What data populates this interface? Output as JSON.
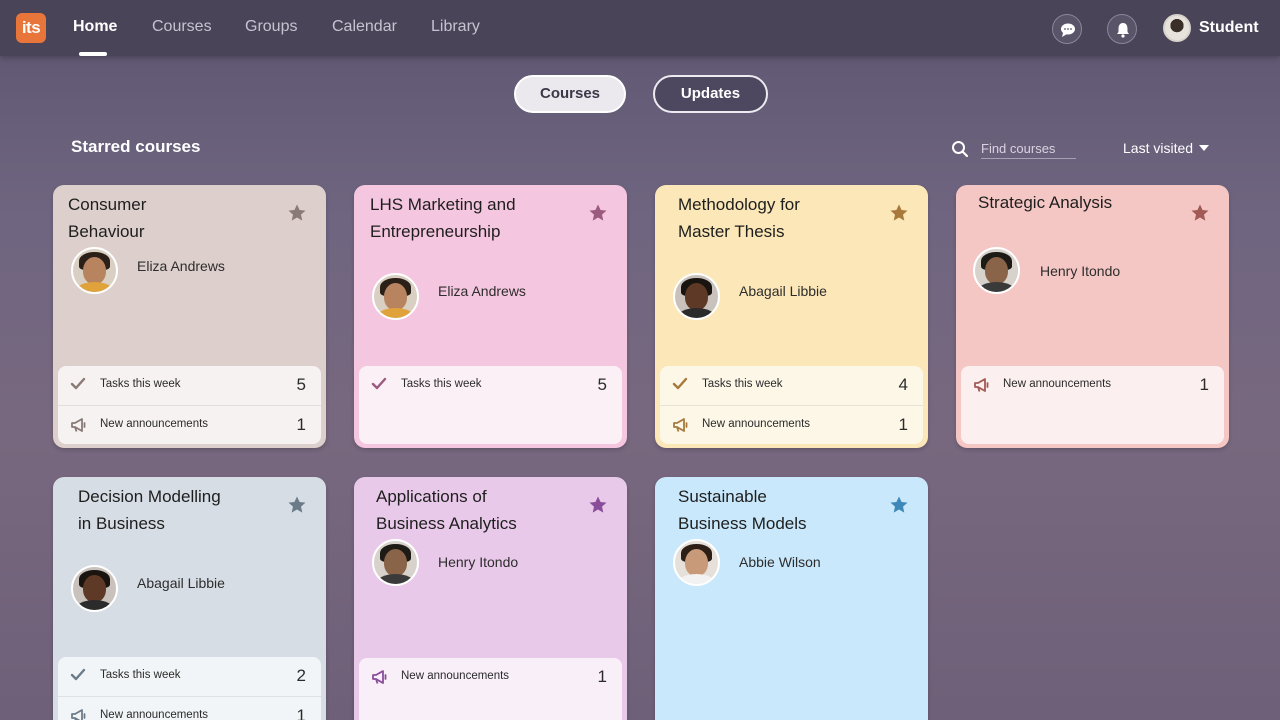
{
  "app": {
    "logo_text": "its"
  },
  "nav": {
    "items": [
      {
        "label": "Home"
      },
      {
        "label": "Courses"
      },
      {
        "label": "Groups"
      },
      {
        "label": "Calendar"
      },
      {
        "label": "Library"
      }
    ],
    "user_name": "Student"
  },
  "segmented": {
    "courses": "Courses",
    "updates": "Updates"
  },
  "section": {
    "title": "Starred courses",
    "search_placeholder": "Find courses",
    "sort_label": "Last visited"
  },
  "stat_labels": {
    "tasks": "Tasks this week",
    "announcements": "New announcements"
  },
  "cards": [
    {
      "title": "Consumer\nBehaviour",
      "teacher": "Eliza Andrews",
      "tasks": "5",
      "announcements": "1",
      "color": "#ddd0cc",
      "accent": "#8a7a76"
    },
    {
      "title": "LHS Marketing and\nEntrepreneurship",
      "teacher": "Eliza Andrews",
      "tasks": "5",
      "color": "#f5c6df",
      "accent": "#9a5b7e"
    },
    {
      "title": "Methodology for\nMaster Thesis",
      "teacher": "Abagail Libbie",
      "tasks": "4",
      "announcements": "1",
      "color": "#fbe7b7",
      "accent": "#a77a3c"
    },
    {
      "title": "Strategic Analysis",
      "teacher": "Henry Itondo",
      "announcements": "1",
      "color": "#f5c7c4",
      "accent": "#a25a56"
    },
    {
      "title": "Decision Modelling\nin Business",
      "teacher": "Abagail Libbie",
      "tasks": "2",
      "announcements": "1",
      "color": "#d6dde4",
      "accent": "#6c7b89"
    },
    {
      "title": "Applications of\nBusiness Analytics",
      "teacher": "Henry Itondo",
      "announcements": "1",
      "color": "#e9c9e9",
      "accent": "#8a4d9a"
    },
    {
      "title": "Sustainable\nBusiness Models",
      "teacher": "Abbie Wilson",
      "color": "#c9e8fb",
      "accent": "#3d88b8"
    }
  ]
}
